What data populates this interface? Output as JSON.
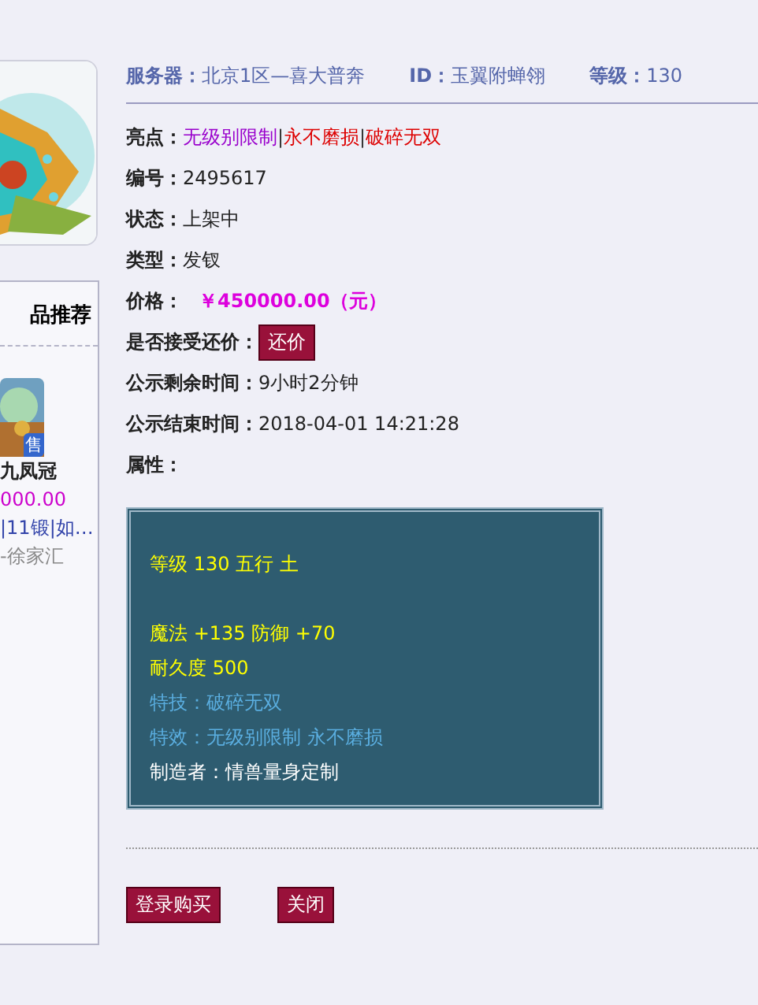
{
  "sidebar": {
    "title": "品推荐",
    "item": {
      "badge": "售",
      "name": "九凤冠",
      "price": "000.00",
      "tags": "|11锻|如…",
      "server": "-徐家汇"
    }
  },
  "header": [
    {
      "label": "服务器：",
      "value": "北京1区—喜大普奔"
    },
    {
      "label": "ID：",
      "value": "玉翼附蝉翎"
    },
    {
      "label": "等级：",
      "value": "130"
    }
  ],
  "highlights": {
    "label": "亮点：",
    "separator": "|",
    "items": [
      {
        "text": "无级别限制",
        "color": "#9900cc"
      },
      {
        "text": "永不磨损",
        "color": "#dd0000"
      },
      {
        "text": "破碎无双",
        "color": "#dd0000"
      }
    ]
  },
  "fields": [
    {
      "kind": "text",
      "label": "编号：",
      "value": "2495617"
    },
    {
      "kind": "text",
      "label": "状态：",
      "value": "上架中"
    },
    {
      "kind": "text",
      "label": "类型：",
      "value": "发钗"
    },
    {
      "kind": "price",
      "label": "价格：",
      "value": "￥450000.00（元）"
    },
    {
      "kind": "button",
      "label": "是否接受还价：",
      "value": "还价"
    },
    {
      "kind": "text",
      "label": "公示剩余时间：",
      "value": "9小时2分钟"
    },
    {
      "kind": "text",
      "label": "公示结束时间：",
      "value": "2018-04-01 14:21:28"
    },
    {
      "kind": "heading",
      "label": "属性："
    }
  ],
  "attribute_groups": [
    [
      {
        "text": "等级 130 五行 土",
        "color": "#ffff00"
      }
    ],
    [
      {
        "text": "魔法 +135 防御 +70",
        "color": "#ffff00"
      },
      {
        "text": "耐久度 500",
        "color": "#ffff00"
      },
      {
        "text": "特技：破碎无双",
        "color": "#5aaee0"
      },
      {
        "text": "特效：无级别限制 永不磨损",
        "color": "#5aaee0"
      },
      {
        "text": "制造者：情兽量身定制",
        "color": "#ffffff"
      }
    ]
  ],
  "buttons": [
    "登录购买",
    "关闭"
  ]
}
